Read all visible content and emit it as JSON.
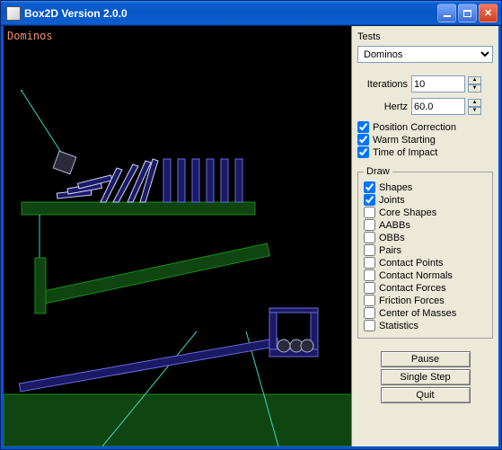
{
  "window": {
    "title": "Box2D Version 2.0.0",
    "min_tooltip": "Minimize",
    "max_tooltip": "Maximize",
    "close_tooltip": "Close"
  },
  "scene_name": "Dominos",
  "panel": {
    "tests_label": "Tests",
    "tests_value": "Dominos",
    "iterations_label": "Iterations",
    "iterations_value": "10",
    "hertz_label": "Hertz",
    "hertz_value": "60.0",
    "sim_checks": [
      {
        "label": "Position Correction",
        "checked": true
      },
      {
        "label": "Warm Starting",
        "checked": true
      },
      {
        "label": "Time of Impact",
        "checked": true
      }
    ],
    "draw_legend": "Draw",
    "draw_checks": [
      {
        "label": "Shapes",
        "checked": true
      },
      {
        "label": "Joints",
        "checked": true
      },
      {
        "label": "Core Shapes",
        "checked": false
      },
      {
        "label": "AABBs",
        "checked": false
      },
      {
        "label": "OBBs",
        "checked": false
      },
      {
        "label": "Pairs",
        "checked": false
      },
      {
        "label": "Contact Points",
        "checked": false
      },
      {
        "label": "Contact Normals",
        "checked": false
      },
      {
        "label": "Contact Forces",
        "checked": false
      },
      {
        "label": "Friction Forces",
        "checked": false
      },
      {
        "label": "Center of Masses",
        "checked": false
      },
      {
        "label": "Statistics",
        "checked": false
      }
    ],
    "pause": "Pause",
    "single_step": "Single Step",
    "quit": "Quit"
  }
}
